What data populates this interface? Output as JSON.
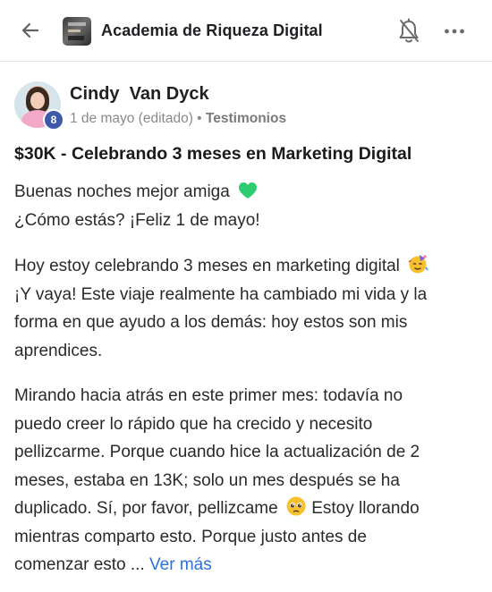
{
  "header": {
    "group_name": "Academia de Riqueza Digital",
    "icons": [
      "arrow-left-icon",
      "bell-off-icon",
      "more-horizontal-icon"
    ]
  },
  "post": {
    "author": "Cindy  Van Dyck",
    "level": "8",
    "date": "1 de mayo (editado)",
    "separator": "•",
    "category": "Testimonios",
    "title": "$30K - Celebrando 3 meses en Marketing Digital",
    "paragraph1": [
      "Buenas noches mejor amiga",
      "¿Cómo estás? ¡Feliz 1 de mayo!"
    ],
    "paragraph2": [
      "Hoy estoy celebrando 3 meses en marketing digital",
      "¡Y vaya! Este viaje realmente ha cambiado mi vida y la",
      "forma en que ayudo a los demás: hoy estos son mis",
      "aprendices."
    ],
    "paragraph3": [
      "Mirando hacia atrás en este primer mes: todavía no",
      "puedo creer lo rápido que ha crecido y necesito",
      "pellizcarme. Porque cuando hice la actualización de 2",
      "meses, estaba en 13K; solo un mes después se ha",
      "duplicado. Sí, por favor, pellizcame",
      "Estoy llorando",
      "mientras comparto esto. Porque justo antes de",
      "comenzar esto ..."
    ],
    "see_more": "Ver más",
    "emojis": [
      "green-heart-icon",
      "partying-face-icon",
      "pleading-face-icon"
    ],
    "colors": {
      "link": "#2f6fd6",
      "badge": "#3d5aa8",
      "heart": "#2ecc71"
    }
  }
}
